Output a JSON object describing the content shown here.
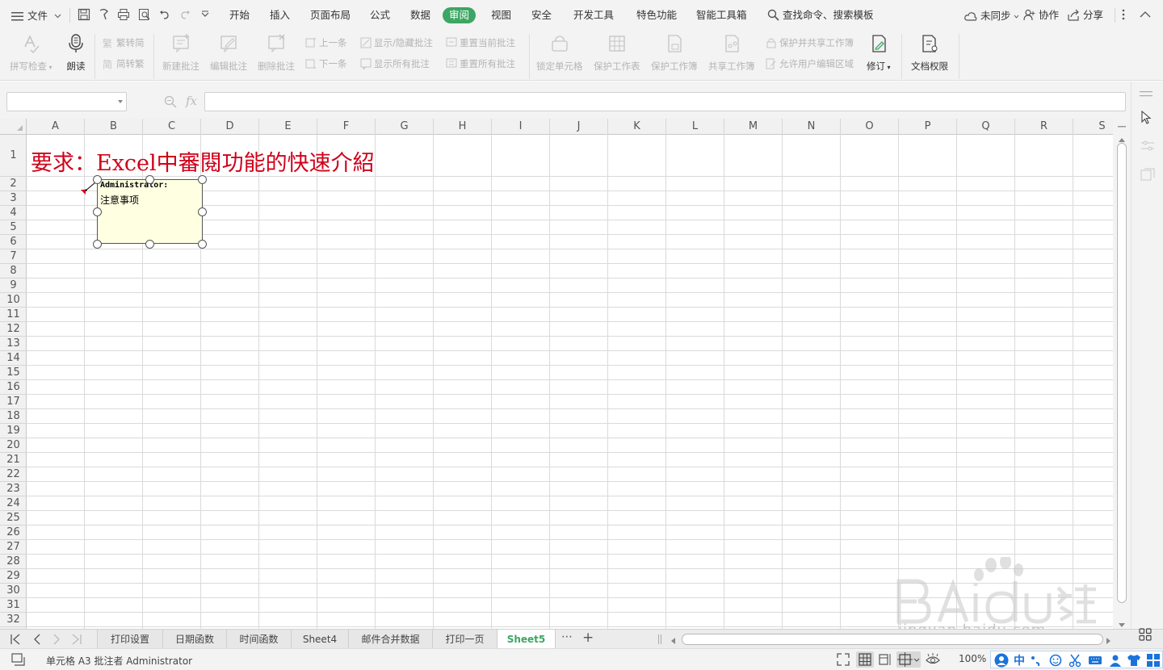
{
  "menubar": {
    "file_label": "文件",
    "tabs": [
      "开始",
      "插入",
      "页面布局",
      "公式",
      "数据",
      "审阅",
      "视图",
      "安全",
      "开发工具",
      "特色功能",
      "智能工具箱"
    ],
    "active_tab": "审阅",
    "search_label": "查找命令、搜索模板",
    "sync_label": "未同步",
    "collab_label": "协作",
    "share_label": "分享"
  },
  "ribbon": {
    "spell_check": "拼写检查",
    "read_aloud": "朗读",
    "trad_to_simp": "繁转简",
    "simp_to_trad": "简转繁",
    "new_comment": "新建批注",
    "edit_comment": "编辑批注",
    "delete_comment": "删除批注",
    "prev_comment": "上一条",
    "next_comment": "下一条",
    "toggle_comments": "显示/隐藏批注",
    "show_all_comments": "显示所有批注",
    "reset_current_comment": "重置当前批注",
    "reset_all_comments": "重置所有批注",
    "lock_cell": "锁定单元格",
    "protect_sheet": "保护工作表",
    "protect_workbook": "保护工作簿",
    "share_workbook": "共享工作簿",
    "protect_and_share": "保护并共享工作簿",
    "allow_edit_ranges": "允许用户编辑区域",
    "track_changes": "修订",
    "doc_permissions": "文档权限"
  },
  "formula_bar": {
    "name_box_value": "",
    "fx_label": "fx",
    "formula_value": ""
  },
  "grid": {
    "columns": [
      "A",
      "B",
      "C",
      "D",
      "E",
      "F",
      "G",
      "H",
      "I",
      "J",
      "K",
      "L",
      "M",
      "N",
      "O",
      "P",
      "Q",
      "R",
      "S"
    ],
    "rows": [
      "1",
      "2",
      "3",
      "4",
      "5",
      "6",
      "7",
      "8",
      "9",
      "10",
      "11",
      "12",
      "13",
      "14",
      "15",
      "16",
      "17",
      "18",
      "19",
      "20",
      "21",
      "22",
      "23",
      "24",
      "25",
      "26",
      "27",
      "28",
      "29",
      "30",
      "31",
      "32"
    ],
    "title_text": "要求：Excel中審閱功能的快速介紹",
    "comment_author": "Administrator:",
    "comment_text": "注意事项"
  },
  "sheet_tabs": {
    "tabs": [
      "打印设置",
      "日期函数",
      "时间函数",
      "Sheet4",
      "邮件合并数据",
      "打印一页",
      "Sheet5"
    ],
    "active": "Sheet5",
    "more_label": "⋯",
    "add_label": "+"
  },
  "status_bar": {
    "text": "单元格 A3 批注者 Administrator",
    "zoom": "100%"
  },
  "watermark": {
    "text": "jingyan.baidu.com"
  },
  "colors": {
    "accent": "#3ca664",
    "title_red": "#d0021b",
    "comment_bg": "#ffffe1"
  }
}
